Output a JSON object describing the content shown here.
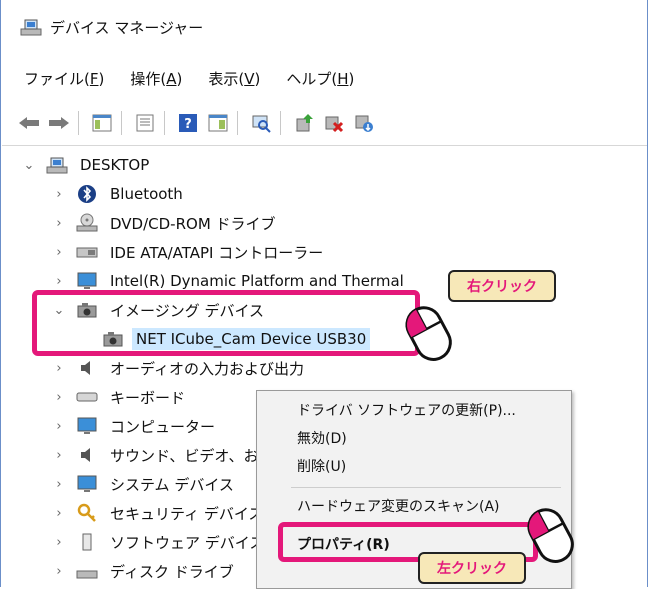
{
  "window": {
    "title": "デバイス マネージャー"
  },
  "menubar": {
    "items": [
      {
        "label": "ファイル(",
        "accel": "F",
        "end": ")"
      },
      {
        "label": "操作(",
        "accel": "A",
        "end": ")"
      },
      {
        "label": "表示(",
        "accel": "V",
        "end": ")"
      },
      {
        "label": "ヘルプ(",
        "accel": "H",
        "end": ")"
      }
    ]
  },
  "toolbar": {
    "buttons": [
      "back-icon",
      "forward-icon",
      "show-hide-console-tree-icon",
      "properties-icon",
      "help-icon",
      "view-icon",
      "scan-hardware-icon",
      "update-driver-icon",
      "uninstall-icon",
      "enable-device-icon"
    ]
  },
  "tree": {
    "root": "DESKTOP",
    "items": [
      {
        "label": "Bluetooth",
        "icon": "bluetooth-icon"
      },
      {
        "label": "DVD/CD-ROM ドライブ",
        "icon": "dvd-drive-icon"
      },
      {
        "label": "IDE ATA/ATAPI コントローラー",
        "icon": "ide-controller-icon"
      },
      {
        "label": "Intel(R) Dynamic Platform and Thermal",
        "icon": "monitor-icon"
      },
      {
        "label": "イメージング デバイス",
        "icon": "camera-icon"
      },
      {
        "label": "NET ICube_Cam Device USB30",
        "icon": "camera-icon"
      },
      {
        "label": "オーディオの入力および出力",
        "icon": "speaker-icon"
      },
      {
        "label": "キーボード",
        "icon": "keyboard-icon"
      },
      {
        "label": "コンピューター",
        "icon": "computer-icon"
      },
      {
        "label": "サウンド、ビデオ、お",
        "icon": "sound-icon"
      },
      {
        "label": "システム デバイス",
        "icon": "system-device-icon"
      },
      {
        "label": "セキュリティ デバイス",
        "icon": "security-device-icon"
      },
      {
        "label": "ソフトウェア デバイス",
        "icon": "software-device-icon"
      },
      {
        "label": "ディスク ドライブ",
        "icon": "disk-drive-icon"
      }
    ]
  },
  "context_menu": {
    "update_driver": "ドライバ ソフトウェアの更新(P)...",
    "disable": "無効(D)",
    "uninstall": "削除(U)",
    "scan": "ハードウェア変更のスキャン(A)",
    "properties": "プロパティ(R)"
  },
  "annotations": {
    "right_click": "右クリック",
    "left_click": "左クリック"
  },
  "colors": {
    "highlight": "#e4187a",
    "callout_bg": "#f7e8b8",
    "selection": "#cce8ff"
  }
}
